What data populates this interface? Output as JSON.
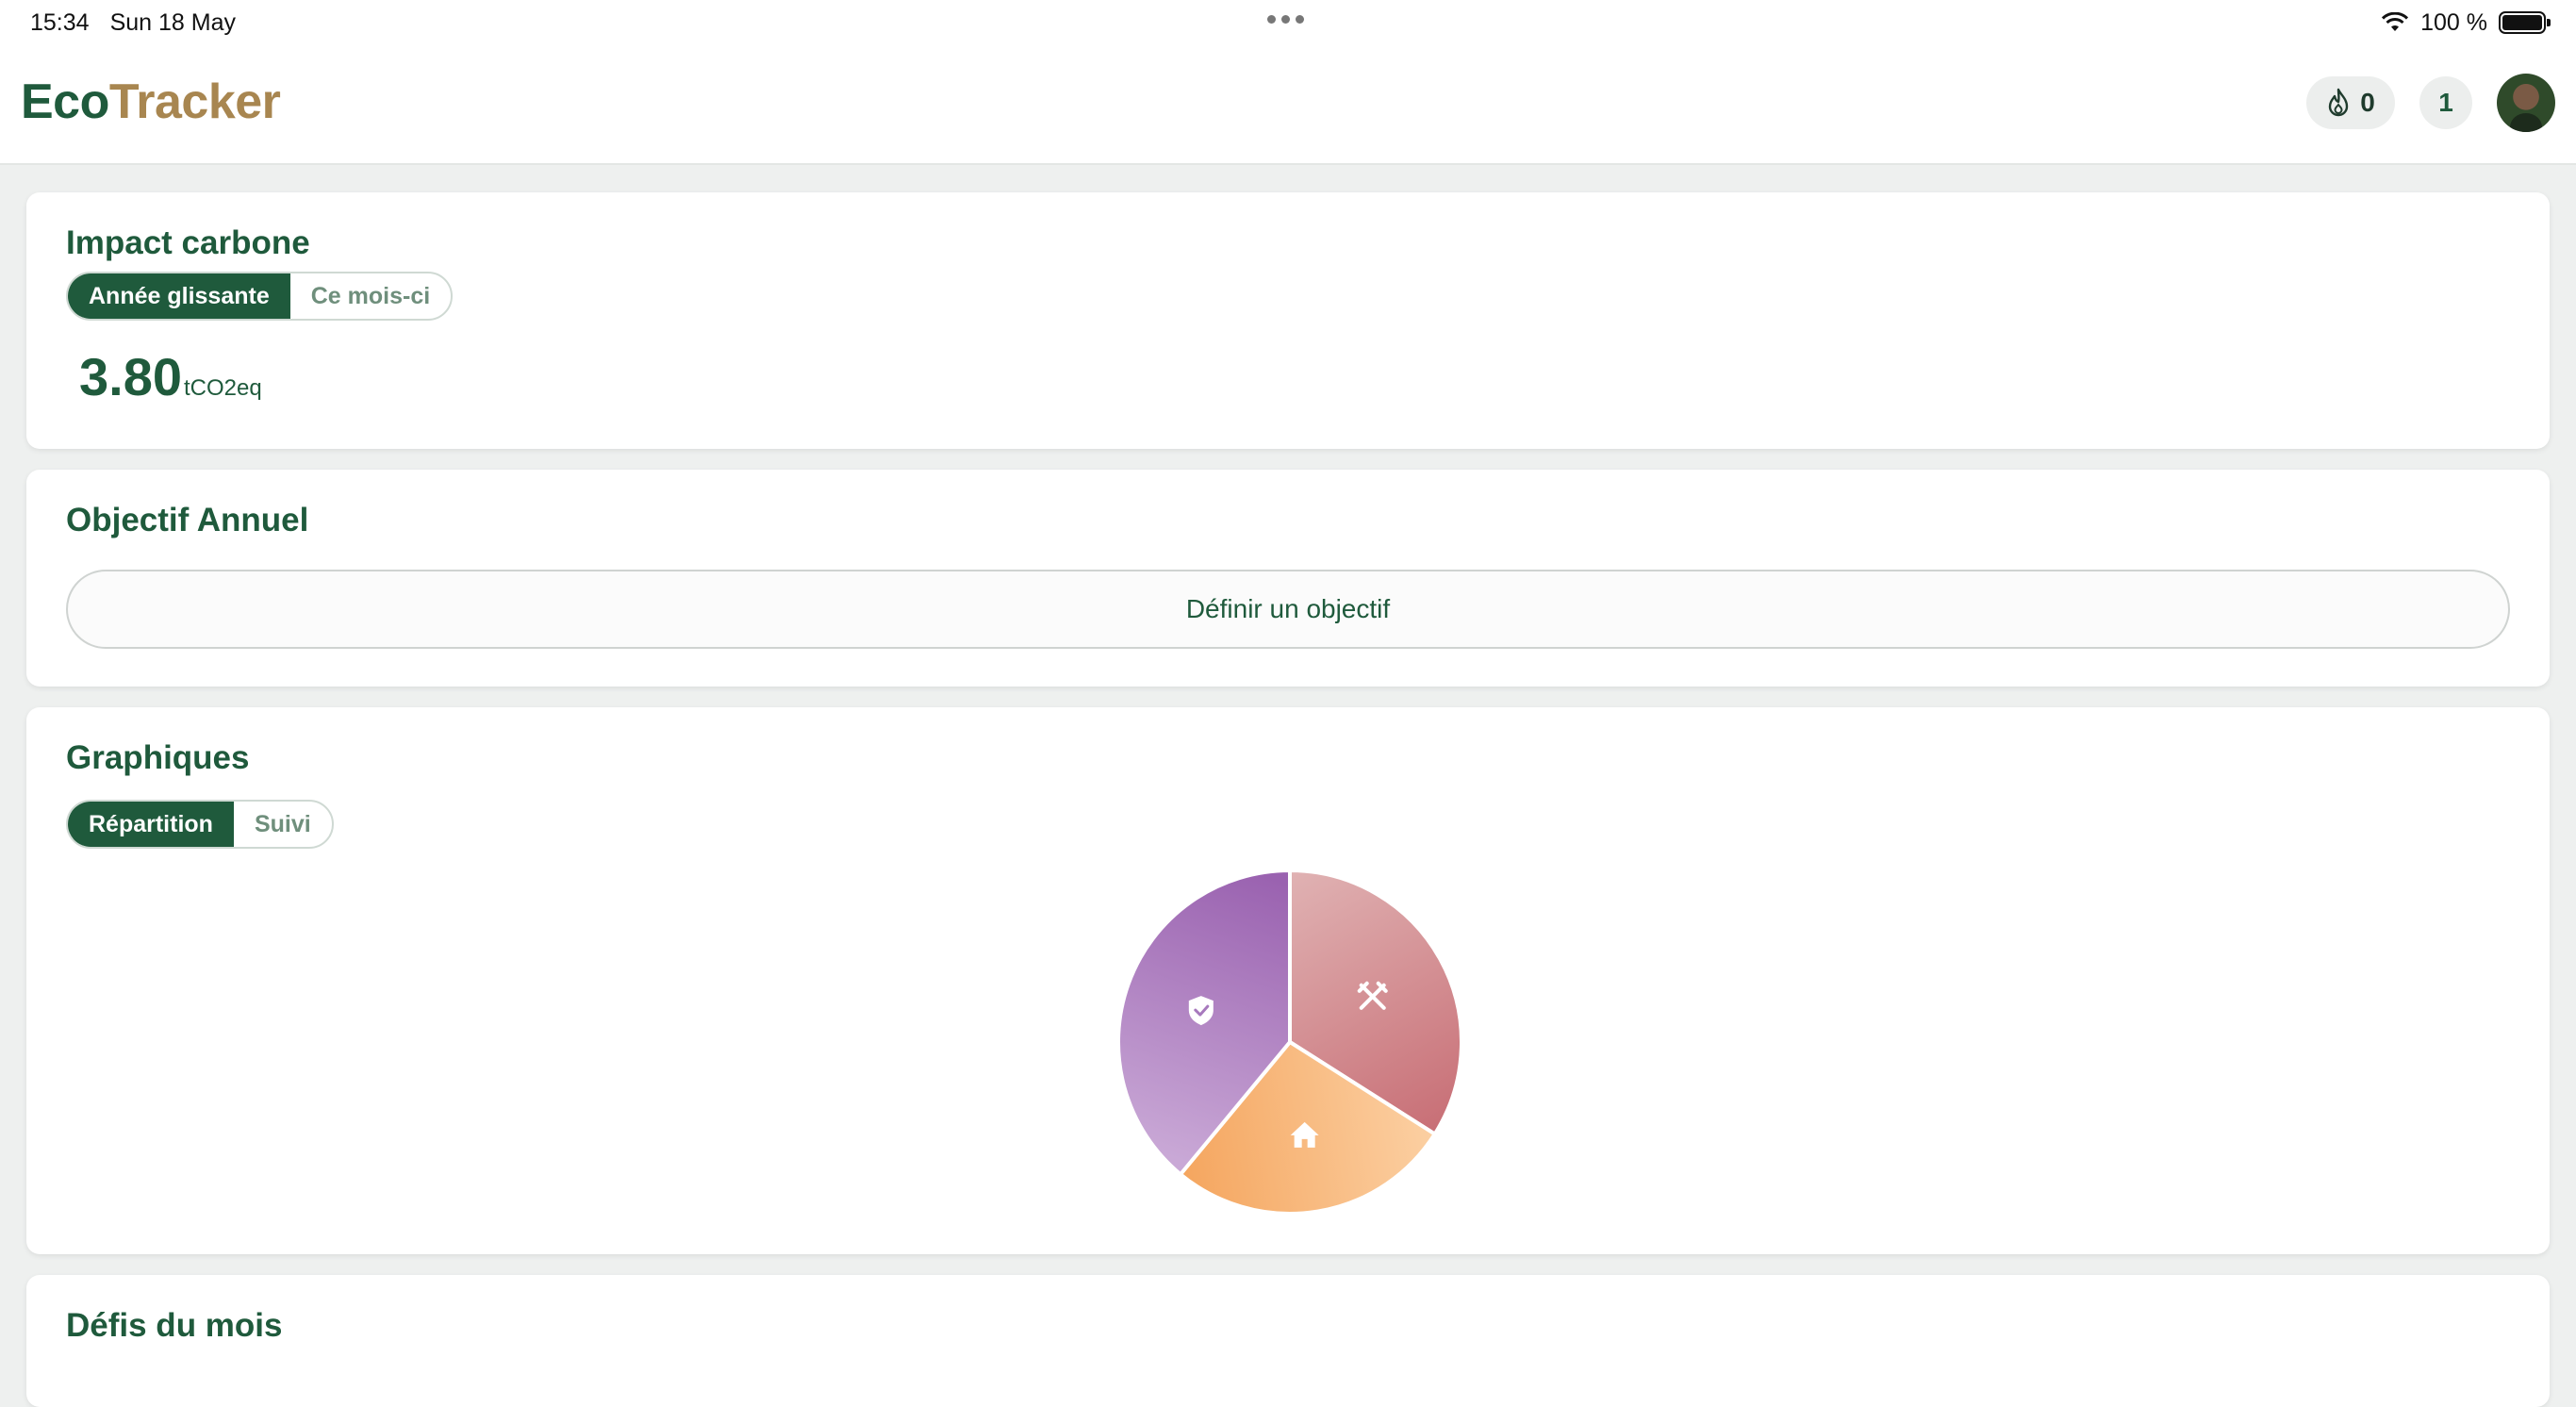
{
  "status": {
    "time": "15:34",
    "date": "Sun 18 May",
    "battery": "100 %"
  },
  "app": {
    "logo_part1": "Eco",
    "logo_part2": "Tracker"
  },
  "header": {
    "streak_count": "0",
    "notif_count": "1"
  },
  "impact": {
    "title": "Impact carbone",
    "tabs": [
      "Année glissante",
      "Ce mois-ci"
    ],
    "active_tab": "Année glissante",
    "value": "3.80",
    "unit": "tCO2eq"
  },
  "objective": {
    "title": "Objectif Annuel",
    "button": "Définir un objectif"
  },
  "charts": {
    "title": "Graphiques",
    "tabs": [
      "Répartition",
      "Suivi"
    ],
    "active_tab": "Répartition"
  },
  "chart_data": {
    "type": "pie",
    "slices": [
      {
        "icon": "cutlery-icon",
        "value": 34,
        "color_from": "#c86f76",
        "color_to": "#e0b2b3"
      },
      {
        "icon": "home-icon",
        "value": 27,
        "color_from": "#f4a259",
        "color_to": "#fcd3a8"
      },
      {
        "icon": "shield-check-icon",
        "value": 39,
        "color_from": "#9a62b0",
        "color_to": "#c9a8d6"
      }
    ]
  },
  "challenges": {
    "title": "Défis du mois"
  }
}
